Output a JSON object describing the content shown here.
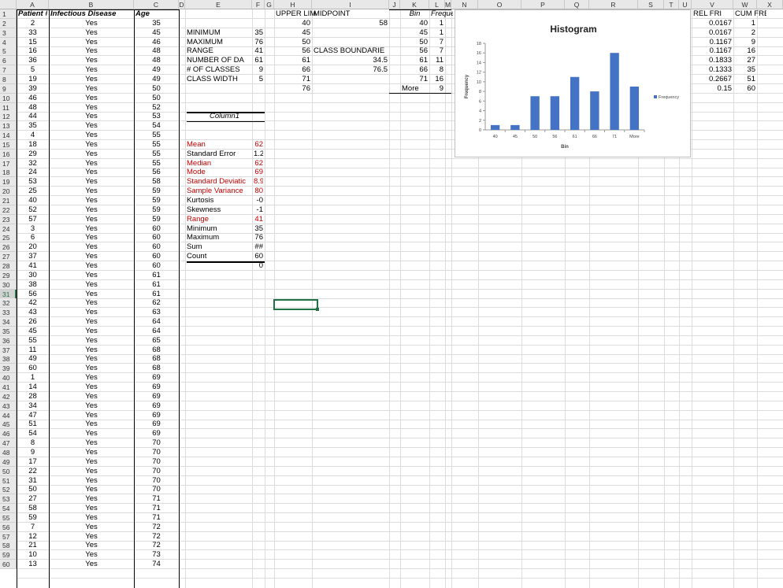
{
  "columns": [
    "A",
    "B",
    "C",
    "D",
    "E",
    "F",
    "G",
    "H",
    "I",
    "J",
    "K",
    "L",
    "M",
    "N",
    "O",
    "P",
    "Q",
    "R",
    "S",
    "T",
    "U",
    "V",
    "W",
    "X"
  ],
  "rows": [
    "1",
    "2",
    "3",
    "4",
    "5",
    "6",
    "7",
    "8",
    "9",
    "10",
    "11",
    "12",
    "13",
    "14",
    "15",
    "16",
    "17",
    "18",
    "19",
    "20",
    "21",
    "22",
    "23",
    "24",
    "25",
    "26",
    "27",
    "28",
    "29",
    "30",
    "31",
    "32",
    "33",
    "34",
    "35",
    "36",
    "37",
    "38",
    "39",
    "40",
    "41",
    "42",
    "43",
    "44",
    "45",
    "46",
    "47",
    "48",
    "49",
    "50",
    "51",
    "52",
    "53",
    "54",
    "55",
    "56",
    "57",
    "58",
    "59",
    "60"
  ],
  "headers": {
    "patient": "Patient #",
    "disease": "Infectious Disease",
    "age": "Age"
  },
  "patients": [
    "2",
    "33",
    "15",
    "16",
    "36",
    "5",
    "19",
    "39",
    "46",
    "48",
    "44",
    "35",
    "4",
    "18",
    "29",
    "32",
    "24",
    "53",
    "25",
    "40",
    "52",
    "57",
    "3",
    "6",
    "20",
    "37",
    "41",
    "30",
    "38",
    "56",
    "42",
    "43",
    "26",
    "45",
    "55",
    "11",
    "49",
    "60",
    "1",
    "14",
    "28",
    "34",
    "47",
    "51",
    "54",
    "8",
    "9",
    "17",
    "22",
    "31",
    "50",
    "27",
    "58",
    "59",
    "7",
    "12",
    "21",
    "10",
    "13"
  ],
  "disease_values": [
    "Yes",
    "Yes",
    "Yes",
    "Yes",
    "Yes",
    "Yes",
    "Yes",
    "Yes",
    "Yes",
    "Yes",
    "Yes",
    "Yes",
    "Yes",
    "Yes",
    "Yes",
    "Yes",
    "Yes",
    "Yes",
    "Yes",
    "Yes",
    "Yes",
    "Yes",
    "Yes",
    "Yes",
    "Yes",
    "Yes",
    "Yes",
    "Yes",
    "Yes",
    "Yes",
    "Yes",
    "Yes",
    "Yes",
    "Yes",
    "Yes",
    "Yes",
    "Yes",
    "Yes",
    "Yes",
    "Yes",
    "Yes",
    "Yes",
    "Yes",
    "Yes",
    "Yes",
    "Yes",
    "Yes",
    "Yes",
    "Yes",
    "Yes",
    "Yes",
    "Yes",
    "Yes",
    "Yes",
    "Yes",
    "Yes",
    "Yes",
    "Yes",
    "Yes"
  ],
  "ages": [
    "35",
    "45",
    "46",
    "48",
    "48",
    "49",
    "49",
    "50",
    "50",
    "52",
    "53",
    "54",
    "55",
    "55",
    "55",
    "55",
    "56",
    "58",
    "59",
    "59",
    "59",
    "59",
    "60",
    "60",
    "60",
    "60",
    "60",
    "61",
    "61",
    "61",
    "62",
    "63",
    "64",
    "64",
    "65",
    "68",
    "68",
    "68",
    "69",
    "69",
    "69",
    "69",
    "69",
    "69",
    "69",
    "70",
    "70",
    "70",
    "70",
    "70",
    "70",
    "71",
    "71",
    "71",
    "72",
    "72",
    "72",
    "73",
    "74"
  ],
  "summary": [
    {
      "label": "MINIMUM",
      "value": "35"
    },
    {
      "label": "MAXIMUM",
      "value": "76"
    },
    {
      "label": "RANGE",
      "value": "41"
    },
    {
      "label": "NUMBER OF DA",
      "value": "61"
    },
    {
      "label": "# OF CLASSES",
      "value": "9"
    },
    {
      "label": "CLASS WIDTH",
      "value": "5"
    }
  ],
  "stats_header": "Column1",
  "stats": [
    {
      "label": "Mean",
      "value": "62",
      "red": true
    },
    {
      "label": "Standard Error",
      "value": "1.2",
      "red": false
    },
    {
      "label": "Median",
      "value": "62",
      "red": true
    },
    {
      "label": "Mode",
      "value": "69",
      "red": true
    },
    {
      "label": "Standard Deviatic",
      "value": "8.9",
      "red": true
    },
    {
      "label": "Sample Variance",
      "value": "80",
      "red": true
    },
    {
      "label": "Kurtosis",
      "value": "-0",
      "red": false
    },
    {
      "label": "Skewness",
      "value": "-1",
      "red": false
    },
    {
      "label": "Range",
      "value": "41",
      "red": true
    },
    {
      "label": "Minimum",
      "value": "35",
      "red": false
    },
    {
      "label": "Maximum",
      "value": "76",
      "red": false
    },
    {
      "label": "Sum",
      "value": "##",
      "red": false
    },
    {
      "label": "Count",
      "value": "60",
      "red": false
    }
  ],
  "stats_extra": "0",
  "upper_header": "UPPER LIM",
  "midpoint_header": "MIDPOINT",
  "upper_limits": [
    "40",
    "45",
    "50",
    "56",
    "61",
    "66",
    "71",
    "76"
  ],
  "midpoint_value": "58",
  "class_boundaries_label": "CLASS BOUNDARIE",
  "class_boundaries": [
    "34.5",
    "76.5"
  ],
  "bin_header": "Bin",
  "freq_header": "Frequency",
  "bins": [
    "40",
    "45",
    "50",
    "56",
    "61",
    "66",
    "71",
    "More"
  ],
  "freqs": [
    "1",
    "1",
    "7",
    "7",
    "11",
    "8",
    "16",
    "9"
  ],
  "rel_header": "REL FRI",
  "cum_header": "CUM FREQ",
  "rel_freq": [
    "0.0167",
    "0.0167",
    "0.1167",
    "0.1167",
    "0.1833",
    "0.1333",
    "0.2667",
    "0.15"
  ],
  "cum_freq": [
    "1",
    "2",
    "9",
    "16",
    "27",
    "35",
    "51",
    "60"
  ],
  "chart_data": {
    "type": "bar",
    "title": "Histogram",
    "xlabel": "Bin",
    "ylabel": "Frequency",
    "categories": [
      "40",
      "45",
      "50",
      "56",
      "61",
      "66",
      "71",
      "More"
    ],
    "series": [
      {
        "name": "Frequency",
        "values": [
          1,
          1,
          7,
          7,
          11,
          8,
          16,
          9
        ]
      }
    ],
    "ylim": [
      0,
      18
    ],
    "yticks": [
      "0",
      "2",
      "4",
      "6",
      "8",
      "10",
      "12",
      "14",
      "16",
      "18"
    ],
    "legend": "right",
    "grid": false,
    "bar_color": "#4472c4"
  }
}
